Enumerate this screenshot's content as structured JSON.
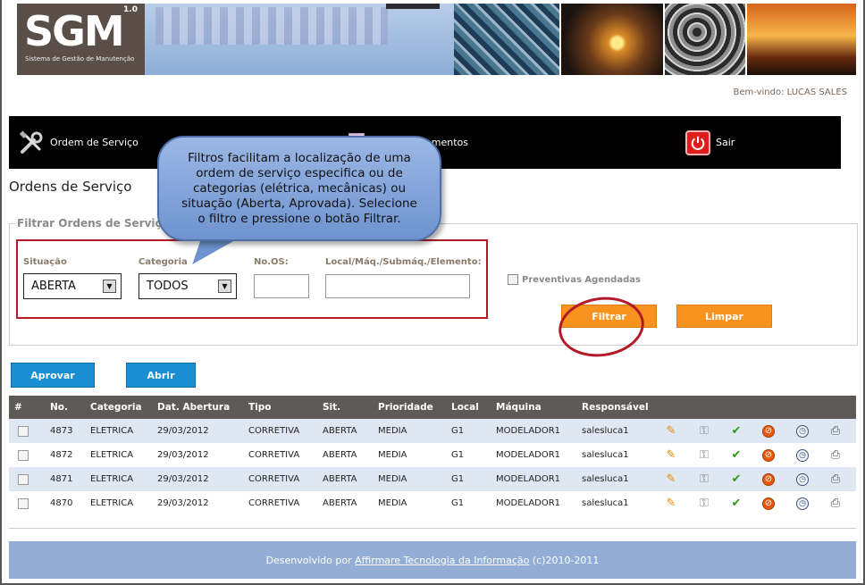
{
  "header": {
    "logo_big": "SGM",
    "logo_version": "1.0",
    "logo_subtitle": "Sistema de Gestão de Manutenção",
    "welcome": "Bem-vindo: LUCAS SALES"
  },
  "menu": {
    "ordem": "Ordem de Serviço",
    "apontamentos": "ontamentos",
    "sair": "Sair"
  },
  "page_title": "Ordens de Serviço",
  "filter": {
    "legend": "Filtrar Ordens de Serviço",
    "situacao_label": "Situação",
    "situacao_value": "ABERTA",
    "categoria_label": "Categoria",
    "categoria_value": "TODOS",
    "no_os_label": "No.OS:",
    "local_label": "Local/Máq./Submáq./Elemento:",
    "preventivas_label": "Preventivas Agendadas",
    "filtrar": "Filtrar",
    "limpar": "Limpar"
  },
  "callout": "Filtros facilitam a localização de uma ordem de serviço especifica ou de categorias (elétrica, mecânicas) ou situação (Aberta, Aprovada). Selecione o filtro e pressione o botão Filtrar.",
  "actions": {
    "aprovar": "Aprovar",
    "abrir": "Abrir"
  },
  "table": {
    "headers": [
      "#",
      "No.",
      "Categoria",
      "Dat. Abertura",
      "Tipo",
      "Sit.",
      "Prioridade",
      "Local",
      "Máquina",
      "Responsável"
    ],
    "rows": [
      [
        "4873",
        "ELETRICA",
        "29/03/2012",
        "CORRETIVA",
        "ABERTA",
        "MEDIA",
        "G1",
        "MODELADOR1",
        "salesluca1"
      ],
      [
        "4872",
        "ELETRICA",
        "29/03/2012",
        "CORRETIVA",
        "ABERTA",
        "MEDIA",
        "G1",
        "MODELADOR1",
        "salesluca1"
      ],
      [
        "4871",
        "ELETRICA",
        "29/03/2012",
        "CORRETIVA",
        "ABERTA",
        "MEDIA",
        "G1",
        "MODELADOR1",
        "salesluca1"
      ],
      [
        "4870",
        "ELETRICA",
        "29/03/2012",
        "CORRETIVA",
        "ABERTA",
        "MEDIA",
        "G1",
        "MODELADOR1",
        "salesluca1"
      ]
    ]
  },
  "footer": {
    "prefix": "Desenvolvido por",
    "link": "Affirmare Tecnologia da Informação",
    "suffix": "(c)2010-2011"
  },
  "colors": {
    "accent_orange": "#f7931e",
    "accent_blue": "#1a8ed3",
    "menu_bg": "#000000",
    "table_header": "#5e5a58",
    "row_alt": "#dfe7f3",
    "footer_bg": "#93aed6",
    "annotation_red": "#b31a28"
  }
}
